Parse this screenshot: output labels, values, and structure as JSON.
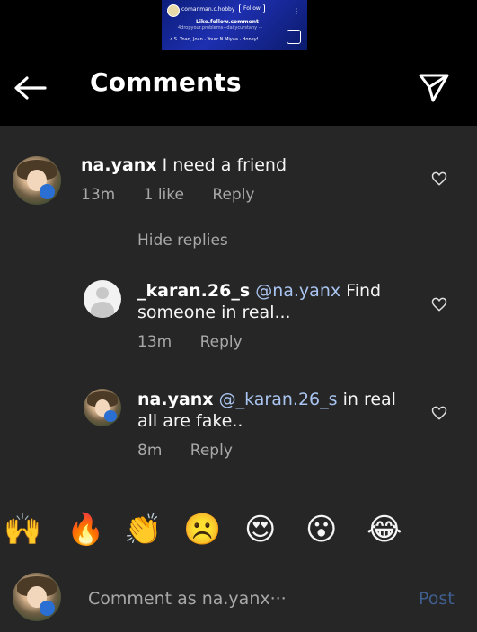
{
  "thumbnail": {
    "username": "comanman.c.hobby",
    "follow_label": "Follow",
    "title": "Like.follow.comment",
    "subtitle": "4dropyour.problems+dailycurstany ···",
    "names": "↗ S. Yoan, Joan · Yourr N Miyaa · Honey!"
  },
  "header": {
    "title": "Comments"
  },
  "comments": [
    {
      "username": "na.yanx",
      "text": "I need a friend",
      "time": "13m",
      "likes": "1 like",
      "reply_label": "Reply"
    }
  ],
  "hide_replies_label": "Hide replies",
  "replies": [
    {
      "username": "_karan.26_s",
      "mention": "@na.yanx",
      "text": "Find someone in real...",
      "time": "13m",
      "reply_label": "Reply"
    },
    {
      "username": "na.yanx",
      "mention": "@_karan.26_s",
      "text": "in real all are fake..",
      "time": "8m",
      "reply_label": "Reply"
    }
  ],
  "emojis": [
    "🙌",
    "🔥",
    "👏",
    "☹️",
    "😍",
    "😮",
    "😂"
  ],
  "composer": {
    "placeholder": "Comment as na.yanx···",
    "post_label": "Post"
  },
  "icons": {
    "back": "arrow-left-icon",
    "send": "paper-plane-icon",
    "like": "heart-outline-icon"
  },
  "colors": {
    "background": "#262626",
    "header": "#000000",
    "mention": "#a9c4f0",
    "post": "#3f5f8f",
    "muted": "#a8a8a8"
  }
}
